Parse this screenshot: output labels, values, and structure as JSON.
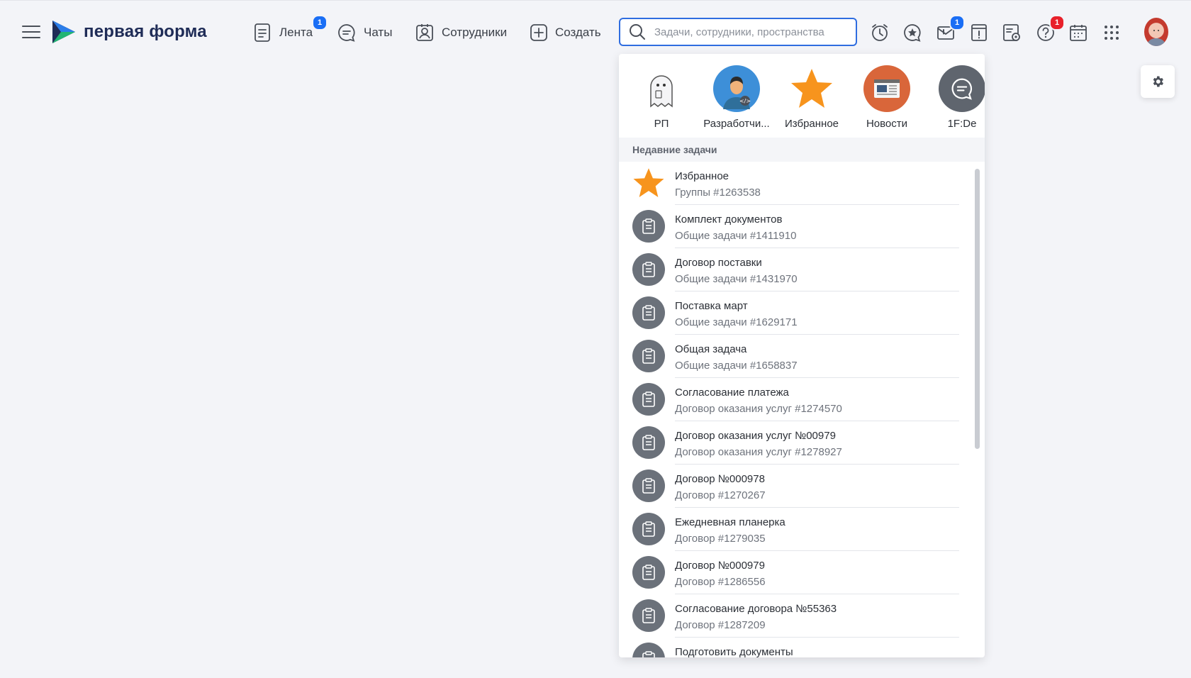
{
  "brand": {
    "name": "первая форма"
  },
  "nav": {
    "items": [
      {
        "label": "Лента",
        "badge": "1"
      },
      {
        "label": "Чаты"
      },
      {
        "label": "Сотрудники"
      },
      {
        "label": "Создать"
      }
    ]
  },
  "search": {
    "placeholder": "Задачи, сотрудники, пространства"
  },
  "toolbar": {
    "icons": [
      "alarm-clock-icon",
      "star-chat-icon",
      "mail-alert-icon",
      "warning-note-icon",
      "document-settings-icon",
      "help-icon",
      "calendar-icon",
      "apps-grid-icon"
    ],
    "mail_badge": "1",
    "help_badge": "1"
  },
  "dropdown": {
    "spaces": [
      {
        "label": "РП",
        "icon": "ghost-icon"
      },
      {
        "label": "Разработчи...",
        "icon": "developer-avatar-icon"
      },
      {
        "label": "Избранное",
        "icon": "star-icon"
      },
      {
        "label": "Новости",
        "icon": "news-icon"
      },
      {
        "label": "1F:De",
        "icon": "chat-bubble-icon"
      }
    ],
    "section_title": "Недавние задачи",
    "recent": [
      {
        "title": "Избранное",
        "sub": "Группы #1263538",
        "icon": "star"
      },
      {
        "title": "Комплект документов",
        "sub": "Общие задачи #1411910",
        "icon": "clipboard"
      },
      {
        "title": "Договор поставки",
        "sub": "Общие задачи #1431970",
        "icon": "clipboard"
      },
      {
        "title": "Поставка март",
        "sub": "Общие задачи #1629171",
        "icon": "clipboard"
      },
      {
        "title": "Общая задача",
        "sub": "Общие задачи #1658837",
        "icon": "clipboard"
      },
      {
        "title": "Согласование платежа",
        "sub": "Договор оказания услуг #1274570",
        "icon": "clipboard"
      },
      {
        "title": "Договор оказания услуг №00979",
        "sub": "Договор оказания услуг #1278927",
        "icon": "clipboard"
      },
      {
        "title": "Договор №000978",
        "sub": "Договор #1270267",
        "icon": "clipboard"
      },
      {
        "title": "Ежедневная планерка",
        "sub": "Договор #1279035",
        "icon": "clipboard"
      },
      {
        "title": "Договор №000979",
        "sub": "Договор #1286556",
        "icon": "clipboard"
      },
      {
        "title": "Согласование договора №55363",
        "sub": "Договор #1287209",
        "icon": "clipboard"
      },
      {
        "title": "Подготовить документы",
        "sub": "",
        "icon": "clipboard"
      }
    ]
  },
  "colors": {
    "accent": "#2f6de0",
    "badge_blue": "#1a6ef5",
    "badge_red": "#e8202a",
    "star": "#f7941d",
    "task_icon_bg": "#6b717a"
  }
}
